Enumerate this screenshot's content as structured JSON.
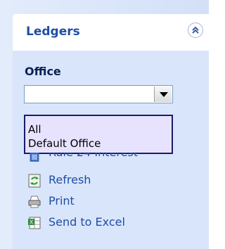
{
  "panel": {
    "title": "Ledgers",
    "collapse_icon": "double-chevron-up-icon"
  },
  "office": {
    "label": "Office",
    "selected": "",
    "options": [
      "All",
      "Default Office"
    ]
  },
  "actions": [
    {
      "label": "Rule 24 Interest",
      "icon": "rule-icon"
    },
    {
      "label": "Refresh",
      "icon": "refresh-icon"
    },
    {
      "label": "Print",
      "icon": "print-icon"
    },
    {
      "label": "Send to Excel",
      "icon": "excel-icon"
    }
  ]
}
